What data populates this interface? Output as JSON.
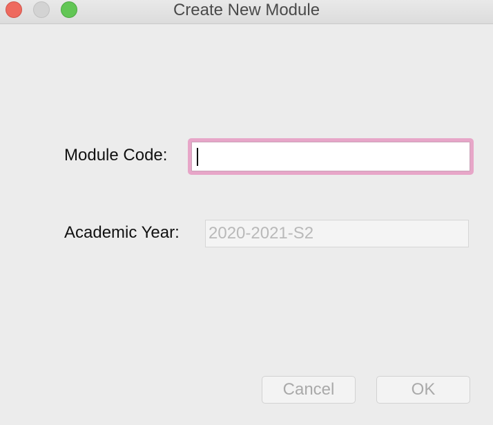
{
  "window": {
    "title": "Create New Module",
    "controls": {
      "close": "close-button",
      "minimize": "minimize-button",
      "zoom": "zoom-button"
    }
  },
  "form": {
    "module_code": {
      "label": "Module Code:",
      "value": ""
    },
    "academic_year": {
      "label": "Academic Year:",
      "value": "2020-2021-S2"
    }
  },
  "buttons": {
    "cancel": "Cancel",
    "ok": "OK"
  },
  "colors": {
    "focus_ring": "#e7a6c8",
    "close": "#ee6a5f",
    "minimize": "#d3d3d3",
    "zoom": "#62c655"
  }
}
